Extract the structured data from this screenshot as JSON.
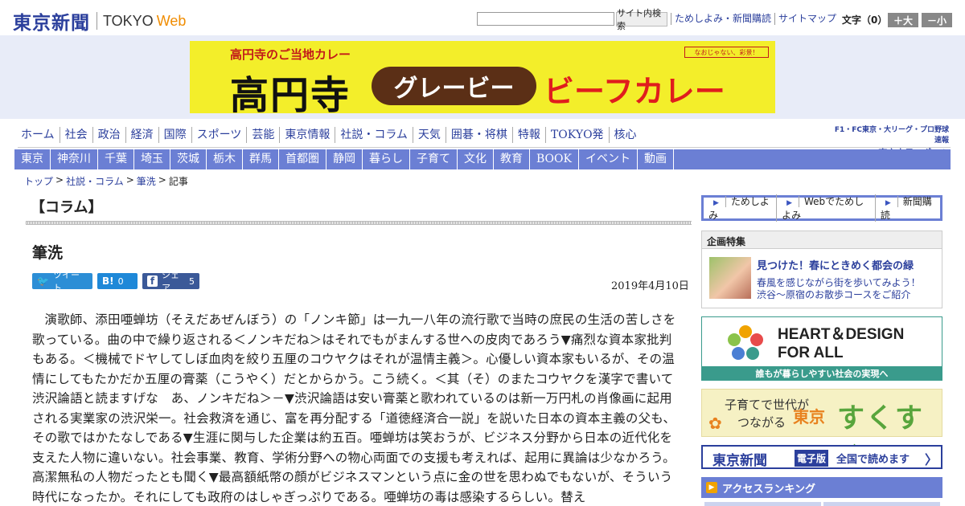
{
  "header": {
    "logo_jp": "東京新聞",
    "logo_en": "TOKYO",
    "logo_en_web": "Web",
    "search_placeholder": "",
    "search_button": "サイト内検索",
    "links": [
      "ためしよみ・新聞購読",
      "サイトマップ"
    ],
    "font_size_label": "文字（0）",
    "font_bigger": "＋大",
    "font_smaller": "－小"
  },
  "ad": {
    "top_text": "高円寺のご当地カレー",
    "big_text": "高円寺",
    "pill_text": "グレービー",
    "right_text": "ビーフカレー",
    "tag_text": "なおじゃない、彩景！"
  },
  "main_nav": [
    "ホーム",
    "社会",
    "政治",
    "経済",
    "国際",
    "スポーツ",
    "芸能",
    "東京情報",
    "社説・コラム",
    "天気",
    "囲碁・将棋",
    "特報",
    "TOKYO発",
    "核心"
  ],
  "chunichi": {
    "line1": "F1・FC東京・大リーグ・プロ野球速報",
    "line2": "東京中日スポーツ"
  },
  "sub_nav": [
    "東京",
    "神奈川",
    "千葉",
    "埼玉",
    "茨城",
    "栃木",
    "群馬",
    "首都圏",
    "静岡",
    "暮らし",
    "子育て",
    "文化",
    "教育",
    "BOOK",
    "イベント",
    "動画"
  ],
  "breadcrumb": {
    "top": "トップ",
    "section": "社説・コラム",
    "column": "筆洗",
    "current": "記事"
  },
  "article": {
    "section_head": "【コラム】",
    "title": "筆洗",
    "tweet": "ツイート",
    "hatena_count": "0",
    "fb_share": "シェア",
    "fb_count": "5",
    "date": "2019年4月10日",
    "body": "演歌師、添田唖蝉坊（そえだあぜんぼう）の「ノンキ節」は一九一八年の流行歌で当時の庶民の生活の苦しさを歌っている。曲の中で繰り返される＜ノンキだね＞はそれでもがまんする世への皮肉であろう▼痛烈な資本家批判もある。＜機械でドヤしてしぼ血肉を絞り五厘のコウヤクはそれが温情主義＞。心優しい資本家もいるが、その温情にしてもたかだか五厘の膏薬（こうやく）だとからかう。こう続く。＜其（そ）のまたコウヤクを漢字で書いて渋沢論語と読ますげな　あ、ノンキだね＞－▼渋沢論語は安い膏薬と歌われているのは新一万円札の肖像画に起用される実業家の渋沢栄一。社会救済を通じ、富を再分配する「道徳経済合一説」を説いた日本の資本主義の父も、その歌ではかたなしである▼生涯に関与した企業は約五百。唖蝉坊は笑おうが、ビジネス分野から日本の近代化を支えた人物に違いない。社会事業、教育、学術分野への物心両面での支援も考えれば、起用に異論は少なかろう。高潔無私の人物だったとも聞く▼最高額紙幣の顔がビジネスマンという点に金の世を思わぬでもないが、そういう時代になったか。それにしても政府のはしゃぎっぷりである。唖蝉坊の毒は感染するらしい。替え"
  },
  "sidebar": {
    "subscribe": [
      "ためしよみ",
      "Webでためしよみ",
      "新聞購読"
    ],
    "kikaku_head": "企画特集",
    "kikaku_title": "見つけた！春にときめく都会の緑",
    "kikaku_desc1": "春風を感じながら街を歩いてみよう！",
    "kikaku_desc2": "渋谷～原宿のお散歩コースをご紹介",
    "hd_title1": "HEART＆DESIGN",
    "hd_title2": "FOR ALL",
    "hd_foot": "誰もが暮らしやすい社会の実現へ",
    "suku_l1": "子育てで世代が",
    "suku_l2": "つながる",
    "suku_brand1": "東京",
    "suku_brand2": "すくすく",
    "denshi_1": "東京新聞",
    "denshi_2": "電子版",
    "denshi_3": "全国で読めます",
    "ranking": "アクセスランキング"
  },
  "colors": {
    "brand_blue": "#2b3f9c",
    "nav_purple": "#6b7fd4",
    "web_orange": "#f08c00"
  }
}
